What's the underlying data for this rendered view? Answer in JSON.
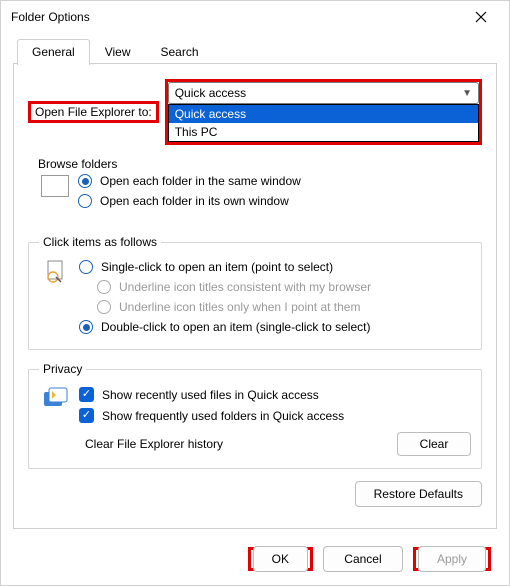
{
  "title": "Folder Options",
  "tabs": {
    "general": "General",
    "view": "View",
    "search": "Search"
  },
  "open_explorer": {
    "label": "Open File Explorer to:",
    "selected": "Quick access",
    "opt_quick": "Quick access",
    "opt_thispc": "This PC"
  },
  "browse": {
    "legend": "Browse folders",
    "same": "Open each folder in the same window",
    "own": "Open each folder in its own window"
  },
  "click": {
    "legend": "Click items as follows",
    "single": "Single-click to open an item (point to select)",
    "underline_browser": "Underline icon titles consistent with my browser",
    "underline_point": "Underline icon titles only when I point at them",
    "double": "Double-click to open an item (single-click to select)"
  },
  "privacy": {
    "legend": "Privacy",
    "recent_files": "Show recently used files in Quick access",
    "freq_folders": "Show frequently used folders in Quick access",
    "clear_label": "Clear File Explorer history",
    "clear_btn": "Clear"
  },
  "restore": "Restore Defaults",
  "footer": {
    "ok": "OK",
    "cancel": "Cancel",
    "apply": "Apply"
  }
}
